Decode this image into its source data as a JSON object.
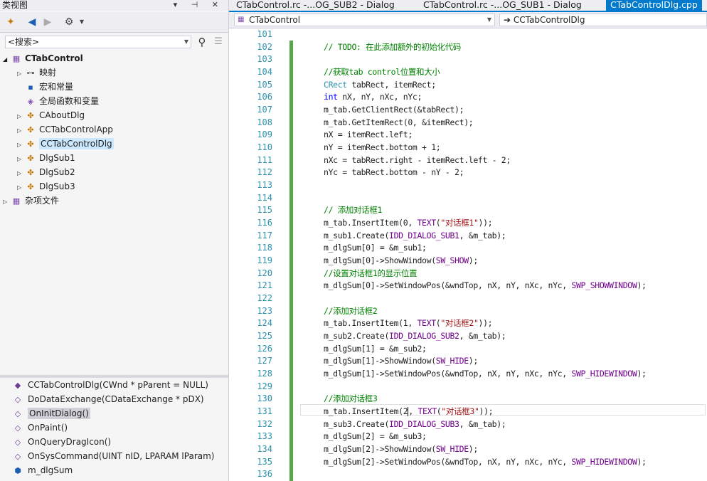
{
  "left_panel": {
    "title": "类视图",
    "window_buttons": "▾ ⊣ ✕",
    "search_placeholder": "<搜索>",
    "tree": [
      {
        "label": "CTabControl",
        "expanded": true,
        "icon": "project-icon",
        "bold": true
      },
      {
        "label": "映射",
        "icon": "map-icon"
      },
      {
        "label": "宏和常量",
        "icon": "macro-icon"
      },
      {
        "label": "全局函数和变量",
        "icon": "global-icon"
      },
      {
        "label": "CAboutDlg",
        "icon": "class-icon"
      },
      {
        "label": "CCTabControlApp",
        "icon": "class-icon"
      },
      {
        "label": "CCTabControlDlg",
        "icon": "class-icon",
        "selected": true
      },
      {
        "label": "DlgSub1",
        "icon": "class-icon"
      },
      {
        "label": "DlgSub2",
        "icon": "class-icon"
      },
      {
        "label": "DlgSub3",
        "icon": "class-icon"
      },
      {
        "label": "杂项文件",
        "icon": "folder-icon"
      }
    ],
    "members": [
      {
        "label": "CCTabControlDlg(CWnd * pParent = NULL)",
        "icon": "method-icon"
      },
      {
        "label": "DoDataExchange(CDataExchange * pDX)",
        "icon": "protected-method-icon"
      },
      {
        "label": "OnInitDialog()",
        "icon": "protected-method-icon",
        "selected": true
      },
      {
        "label": "OnPaint()",
        "icon": "protected-method-icon"
      },
      {
        "label": "OnQueryDragIcon()",
        "icon": "protected-method-icon"
      },
      {
        "label": "OnSysCommand(UINT nID, LPARAM lParam)",
        "icon": "protected-method-icon"
      },
      {
        "label": "m_dlgSum",
        "icon": "field-icon"
      }
    ]
  },
  "tabs": [
    {
      "label": "CTabControl.rc -...OG_SUB2 - Dialog"
    },
    {
      "label": "CTabControl.rc -...OG_SUB1 - Dialog"
    },
    {
      "label": "CTabControlDlg.cpp",
      "active": true
    }
  ],
  "navbar": {
    "scope": "CTabControl",
    "member": "➔ CCTabControlDlg"
  },
  "editor": {
    "line_numbers": [
      "101",
      "102",
      "103",
      "104",
      "105",
      "106",
      "107",
      "108",
      "109",
      "110",
      "111",
      "112",
      "113",
      "114",
      "115",
      "116",
      "117",
      "118",
      "119",
      "120",
      "121",
      "122",
      "123",
      "124",
      "125",
      "126",
      "127",
      "128",
      "129",
      "130",
      "131",
      "132",
      "133",
      "134",
      "135",
      "136"
    ],
    "lines": [
      "",
      "// TODO: 在此添加额外的初始化代码",
      "",
      "//获取tab control位置和大小",
      "CRect tabRect, itemRect;",
      "int nX, nY, nXc, nYc;",
      "m_tab.GetClientRect(&tabRect);",
      "m_tab.GetItemRect(0, &itemRect);",
      "nX = itemRect.left;",
      "nY = itemRect.bottom + 1;",
      "nXc = tabRect.right - itemRect.left - 2;",
      "nYc = tabRect.bottom - nY - 2;",
      "",
      "",
      "// 添加对话框1",
      "m_tab.InsertItem(0, TEXT(\"对话框1\"));",
      "m_sub1.Create(IDD_DIALOG_SUB1, &m_tab);",
      "m_dlgSum[0] = &m_sub1;",
      "m_dlgSum[0]->ShowWindow(SW_SHOW);",
      "//设置对话框1的显示位置",
      "m_dlgSum[0]->SetWindowPos(&wndTop, nX, nY, nXc, nYc, SWP_SHOWWINDOW);",
      "",
      "//添加对话框2",
      "m_tab.InsertItem(1, TEXT(\"对话框2\"));",
      "m_sub2.Create(IDD_DIALOG_SUB2, &m_tab);",
      "m_dlgSum[1] = &m_sub2;",
      "m_dlgSum[1]->ShowWindow(SW_HIDE);",
      "m_dlgSum[1]->SetWindowPos(&wndTop, nX, nY, nXc, nYc, SWP_HIDEWINDOW);",
      "",
      "//添加对话框3",
      "m_tab.InsertItem(2, TEXT(\"对话框3\"));",
      "m_sub3.Create(IDD_DIALOG_SUB3, &m_tab);",
      "m_dlgSum[2] = &m_sub3;",
      "m_dlgSum[2]->ShowWindow(SW_HIDE);",
      "m_dlgSum[2]->SetWindowPos(&wndTop, nX, nY, nXc, nYc, SWP_HIDEWINDOW);",
      ""
    ],
    "current_line_index": 30
  },
  "colors": {
    "accent": "#007acc",
    "comment": "#008000",
    "keyword": "#0000ff",
    "type": "#2b91af",
    "string": "#a31515",
    "macro": "#6f008a",
    "change_bar": "#57a64a"
  }
}
